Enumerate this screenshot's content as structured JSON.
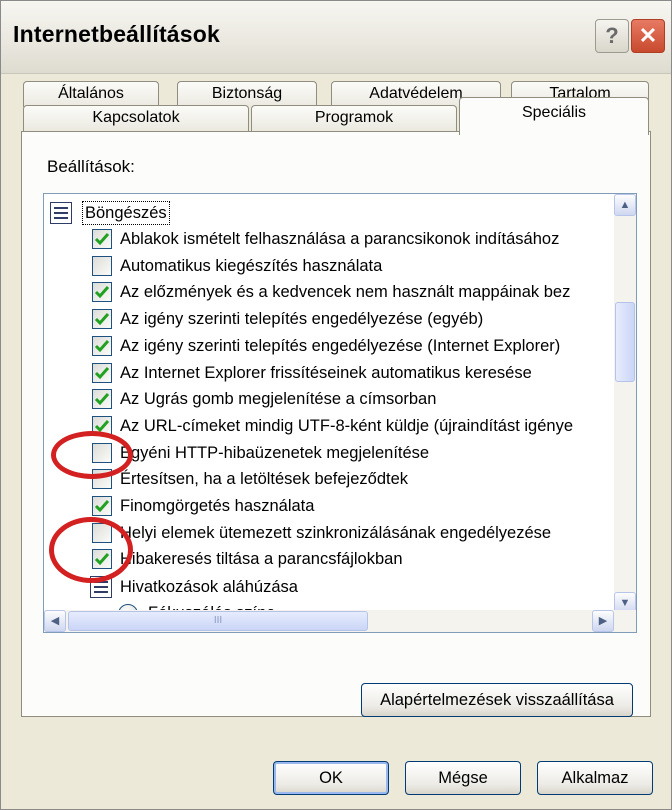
{
  "window": {
    "title": "Internetbeállítások"
  },
  "titlebar": {
    "help_label": "?",
    "close_label": "✕"
  },
  "tabs": {
    "row1": [
      "Általános",
      "Biztonság",
      "Adatvédelem",
      "Tartalom"
    ],
    "row2": [
      "Kapcsolatok",
      "Programok",
      "Speciális"
    ],
    "active": "Speciális"
  },
  "settings": {
    "label": "Beállítások:",
    "category": "Böngészés",
    "items": [
      {
        "label": "Ablakok ismételt felhasználása a parancsikonok indításához",
        "checked": true
      },
      {
        "label": "Automatikus kiegészítés használata",
        "checked": false
      },
      {
        "label": "Az előzmények és a kedvencek nem használt mappáinak bez",
        "checked": true
      },
      {
        "label": "Az igény szerinti telepítés engedélyezése (egyéb)",
        "checked": true
      },
      {
        "label": "Az igény szerinti telepítés engedélyezése (Internet Explorer)",
        "checked": true
      },
      {
        "label": "Az Internet Explorer frissítéseinek automatikus keresése",
        "checked": true
      },
      {
        "label": "Az Ugrás gomb megjelenítése a címsorban",
        "checked": true
      },
      {
        "label": "Az URL-címeket mindig UTF-8-ként küldje (újraindítást igénye",
        "checked": true
      },
      {
        "label": "Egyéni HTTP-hibaüzenetek megjelenítése",
        "checked": false
      },
      {
        "label": "Értesítsen, ha a letöltések befejeződtek",
        "checked": false
      },
      {
        "label": "Finomgörgetés használata",
        "checked": true
      },
      {
        "label": "Helyi elemek ütemezett szinkronizálásának engedélyezése",
        "checked": false
      },
      {
        "label": "Hibakeresés tiltása a parancsfájlokban",
        "checked": true
      }
    ],
    "subcategory": "Hivatkozások aláhúzása",
    "radio_item": "Fókuszálás színe"
  },
  "scrollbar": {
    "up": "▲",
    "down": "▼",
    "left": "◀",
    "right": "▶",
    "grip": "III"
  },
  "buttons": {
    "restore_defaults": "Alapértelmezések visszaállítása",
    "ok": "OK",
    "cancel": "Mégse",
    "apply": "Alkalmaz"
  },
  "colors": {
    "check": "#21a121",
    "annotation": "#d32020",
    "accent": "#003c74"
  }
}
